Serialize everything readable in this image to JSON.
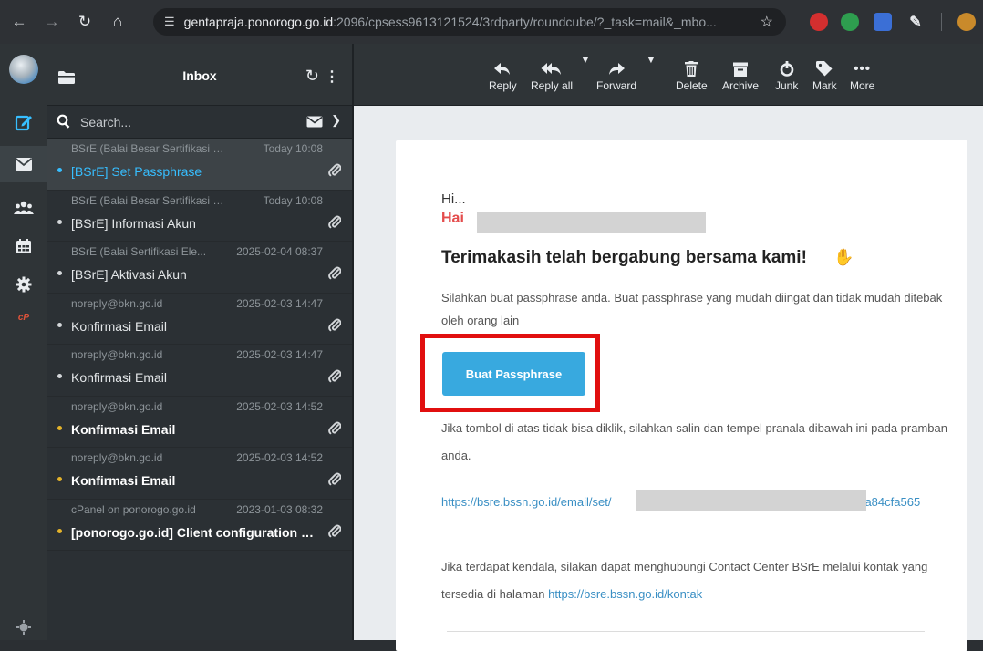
{
  "browser": {
    "url_host": "gentapraja.ponorogo.go.id",
    "url_path": ":2096/cpsess9613121524/3rdparty/roundcube/?_task=mail&_mbo...",
    "icons": [
      "back-icon",
      "forward-icon",
      "reload-icon",
      "home-icon",
      "site-info-icon",
      "star-icon",
      "extensions-icon"
    ]
  },
  "rail": {
    "items": [
      "compose-icon",
      "mail-icon",
      "contacts-icon",
      "calendar-icon",
      "settings-icon",
      "cpanel-icon",
      "about-icon"
    ],
    "cpanel_label": "cP"
  },
  "list": {
    "title": "Inbox",
    "search_placeholder": "Search...",
    "messages": [
      {
        "from": "BSrE (Balai Besar Sertifikasi El...",
        "date": "Today 10:08",
        "subject": "[BSrE] Set Passphrase",
        "state": "selected"
      },
      {
        "from": "BSrE (Balai Besar Sertifikasi El...",
        "date": "Today 10:08",
        "subject": "[BSrE] Informasi Akun",
        "state": "read"
      },
      {
        "from": "BSrE (Balai Sertifikasi Ele...",
        "date": "2025-02-04 08:37",
        "subject": "[BSrE] Aktivasi Akun",
        "state": "read"
      },
      {
        "from": "noreply@bkn.go.id",
        "date": "2025-02-03 14:47",
        "subject": "Konfirmasi Email",
        "state": "read"
      },
      {
        "from": "noreply@bkn.go.id",
        "date": "2025-02-03 14:47",
        "subject": "Konfirmasi Email",
        "state": "read"
      },
      {
        "from": "noreply@bkn.go.id",
        "date": "2025-02-03 14:52",
        "subject": "Konfirmasi Email",
        "state": "unread"
      },
      {
        "from": "noreply@bkn.go.id",
        "date": "2025-02-03 14:52",
        "subject": "Konfirmasi Email",
        "state": "unread"
      },
      {
        "from": "cPanel on ponorogo.go.id",
        "date": "2023-01-03 08:32",
        "subject": "[ponorogo.go.id] Client configuration s...",
        "state": "unread"
      }
    ]
  },
  "toolbar": {
    "reply": "Reply",
    "reply_all": "Reply all",
    "forward": "Forward",
    "delete": "Delete",
    "archive": "Archive",
    "junk": "Junk",
    "mark": "Mark",
    "more": "More"
  },
  "email": {
    "greeting": "Hi...",
    "hai": "Hai",
    "heading": "Terimakasih telah bergabung bersama kami!",
    "paragraph1": "Silahkan buat passphrase anda. Buat passphrase yang mudah diingat dan tidak mudah ditebak oleh orang lain",
    "button": "Buat Passphrase",
    "paragraph2": "Jika tombol di atas tidak bisa diklik, silahkan salin dan tempel pranala dibawah ini pada pramban anda.",
    "link_start": "https://bsre.bssn.go.id/email/set/",
    "link_end": "-363a84cfa565",
    "paragraph3": "Jika terdapat kendala, silakan dapat menghubungi Contact Center BSrE melalui kontak yang tersedia di halaman",
    "paragraph3_link": "https://bsre.bssn.go.id/kontak"
  },
  "colors": {
    "accent": "#37beff",
    "button": "#38a9df",
    "highlight": "#e10f0f",
    "hai": "#e44c4c",
    "flag": "#e4b32a"
  }
}
